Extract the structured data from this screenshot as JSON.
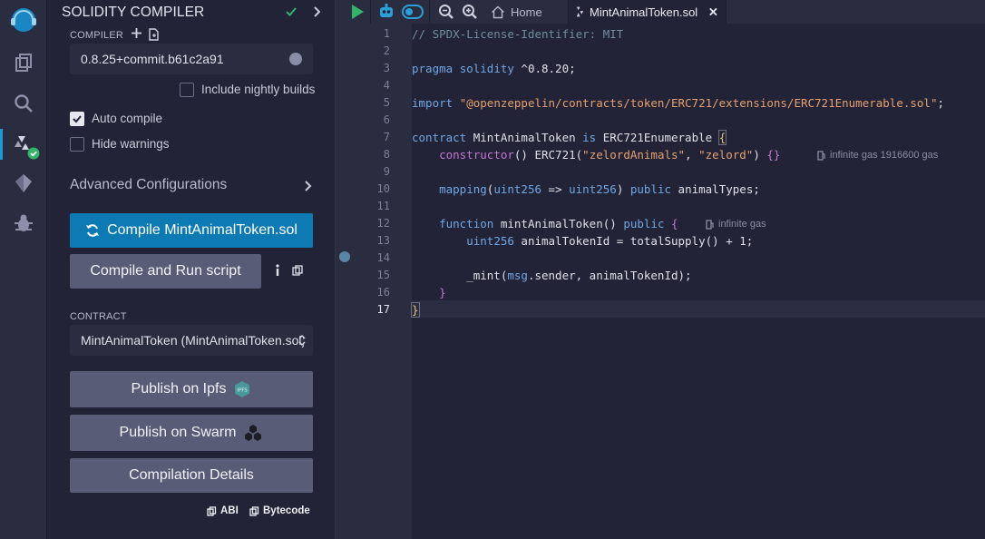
{
  "colors": {
    "accent": "#0e7ab4",
    "success": "#34b36b",
    "panel": "#222336",
    "rail": "#2a2c3f"
  },
  "rail": {
    "icons": [
      "remix-logo-icon",
      "file-explorer-icon",
      "search-icon",
      "solidity-compiler-icon",
      "deploy-icon",
      "debugger-icon"
    ]
  },
  "panel": {
    "title": "SOLIDITY COMPILER",
    "compiler_label": "COMPILER",
    "compiler_version": "0.8.25+commit.b61c2a91",
    "include_nightly": "Include nightly builds",
    "auto_compile": "Auto compile",
    "auto_compile_checked": true,
    "hide_warnings": "Hide warnings",
    "advanced": "Advanced Configurations",
    "compile_btn": "Compile MintAnimalToken.sol",
    "run_script_btn": "Compile and Run script",
    "contract_label": "CONTRACT",
    "contract_value": "MintAnimalToken (MintAnimalToken.sol)",
    "publish_ipfs": "Publish on Ipfs",
    "publish_swarm": "Publish on Swarm",
    "details": "Compilation Details",
    "abi": "ABI",
    "bytecode": "Bytecode"
  },
  "editor": {
    "tabs": {
      "home": "Home",
      "file": "MintAnimalToken.sol"
    },
    "current_line": 17,
    "gas": {
      "constructor": "infinite gas 1916600 gas",
      "mint": "infinite gas"
    }
  }
}
